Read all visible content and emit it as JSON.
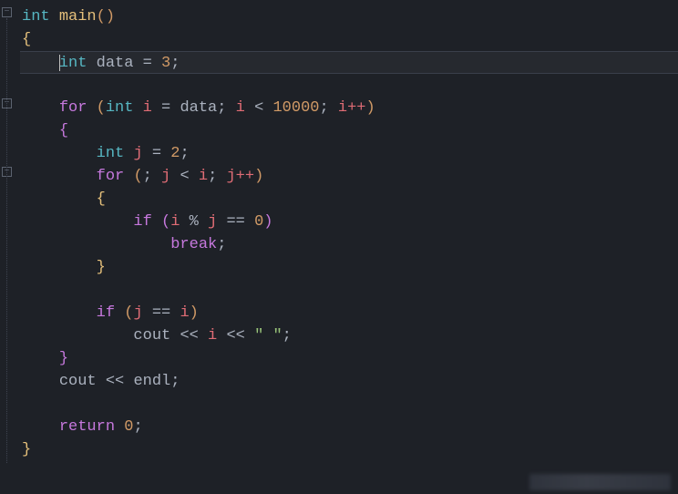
{
  "tokens": {
    "int": "int",
    "main": "main",
    "data": "data",
    "eq": "=",
    "three": "3",
    "for": "for",
    "i": "i",
    "lt": "<",
    "tenk": "10000",
    "ipp": "i++",
    "j": "j",
    "two": "2",
    "jpp": "j++",
    "if": "if",
    "mod": "%",
    "eqeq": "==",
    "zero": "0",
    "break": "break",
    "cout": "cout",
    "ll": "<<",
    "space_str": "\" \"",
    "endl": "endl",
    "return": "return",
    "semi": ";",
    "lbrace": "{",
    "rbrace": "}",
    "lparen": "(",
    "rparen": ")"
  },
  "code_lines": [
    "int main()",
    "{",
    "    int data = 3;",
    "",
    "    for (int i = data; i < 10000; i++)",
    "    {",
    "        int j = 2;",
    "        for (; j < i; j++)",
    "        {",
    "            if (i % j == 0)",
    "                break;",
    "        }",
    "",
    "        if (j == i)",
    "            cout << i << \" \";",
    "    }",
    "    cout << endl;",
    "",
    "    return 0;",
    "}"
  ],
  "cursor_line": 2,
  "folds": [
    0,
    4,
    7
  ]
}
